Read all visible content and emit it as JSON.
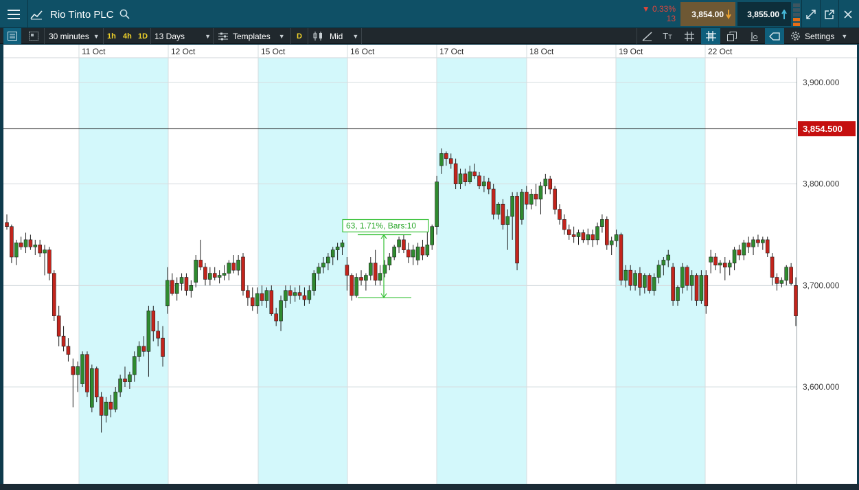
{
  "titlebar": {
    "instrument": "Rio Tinto PLC",
    "change_pct": "▼ 0.33%",
    "change_pts": "13",
    "sell_price": "3,854.00",
    "buy_price": "3,855.00",
    "icons": [
      "menu-icon",
      "chart-icon",
      "search-icon",
      "down-arrow-icon",
      "up-arrow-icon",
      "depth-bars-icon",
      "expand-icon",
      "popout-icon",
      "close-icon"
    ]
  },
  "toolbar": {
    "interval": "30 minutes",
    "btn_1h": "1h",
    "btn_4h": "4h",
    "btn_1d": "1D",
    "period": "13 Days",
    "templates": "Templates",
    "d_btn": "D",
    "price_type": "Mid",
    "settings": "Settings",
    "icons": [
      "list-icon",
      "layout-icon",
      "draw-line-icon",
      "text-icon",
      "grid-icon",
      "crosshair-icon",
      "copy-icon",
      "indicator-icon",
      "tag-icon",
      "gear-icon"
    ]
  },
  "chart_data": {
    "type": "candlestick",
    "x_labels": [
      "11 Oct",
      "12 Oct",
      "15 Oct",
      "16 Oct",
      "17 Oct",
      "18 Oct",
      "19 Oct",
      "22 Oct"
    ],
    "y_ticks": [
      "3,900.000",
      "3,800.000",
      "3,700.000",
      "3,600.000"
    ],
    "y_tick_values": [
      3900,
      3800,
      3700,
      3600
    ],
    "current_price": 3854.5,
    "current_price_label": "3,854.500",
    "measure_label": "63, 1.71%, Bars:10",
    "measure": {
      "from": 3688,
      "to": 3750
    },
    "colors": {
      "up": "#2f8a2f",
      "down": "#c3241c",
      "shade": "#d3f8fb",
      "price_tag": "#c50f0f",
      "measure": "#35c035"
    },
    "candles": [
      [
        3762,
        3770,
        3755,
        3758
      ],
      [
        3758,
        3760,
        3722,
        3728
      ],
      [
        3728,
        3745,
        3720,
        3742
      ],
      [
        3742,
        3748,
        3735,
        3738
      ],
      [
        3738,
        3752,
        3732,
        3745
      ],
      [
        3745,
        3750,
        3735,
        3738
      ],
      [
        3738,
        3745,
        3730,
        3740
      ],
      [
        3740,
        3745,
        3728,
        3732
      ],
      [
        3732,
        3740,
        3710,
        3735
      ],
      [
        3735,
        3738,
        3705,
        3712
      ],
      [
        3712,
        3715,
        3665,
        3670
      ],
      [
        3670,
        3680,
        3640,
        3650
      ],
      [
        3650,
        3660,
        3635,
        3640
      ],
      [
        3640,
        3648,
        3625,
        3632
      ],
      [
        3620,
        3628,
        3580,
        3612
      ],
      [
        3612,
        3625,
        3595,
        3620
      ],
      [
        3603,
        3635,
        3600,
        3632
      ],
      [
        3632,
        3635,
        3590,
        3595
      ],
      [
        3580,
        3622,
        3575,
        3618
      ],
      [
        3618,
        3620,
        3585,
        3590
      ],
      [
        3590,
        3595,
        3555,
        3572
      ],
      [
        3572,
        3590,
        3565,
        3585
      ],
      [
        3585,
        3592,
        3570,
        3578
      ],
      [
        3578,
        3600,
        3575,
        3595
      ],
      [
        3595,
        3612,
        3590,
        3608
      ],
      [
        3608,
        3620,
        3600,
        3605
      ],
      [
        3605,
        3615,
        3598,
        3612
      ],
      [
        3612,
        3635,
        3605,
        3630
      ],
      [
        3630,
        3645,
        3625,
        3640
      ],
      [
        3640,
        3650,
        3630,
        3635
      ],
      [
        3635,
        3680,
        3610,
        3675
      ],
      [
        3675,
        3680,
        3645,
        3655
      ],
      [
        3655,
        3665,
        3640,
        3648
      ],
      [
        3648,
        3660,
        3620,
        3630
      ],
      [
        3680,
        3718,
        3672,
        3705
      ],
      [
        3705,
        3712,
        3690,
        3692
      ],
      [
        3692,
        3708,
        3685,
        3702
      ],
      [
        3702,
        3712,
        3695,
        3708
      ],
      [
        3708,
        3712,
        3690,
        3695
      ],
      [
        3695,
        3705,
        3688,
        3700
      ],
      [
        3703,
        3730,
        3698,
        3725
      ],
      [
        3725,
        3745,
        3715,
        3718
      ],
      [
        3718,
        3722,
        3700,
        3706
      ],
      [
        3706,
        3718,
        3700,
        3712
      ],
      [
        3712,
        3718,
        3705,
        3708
      ],
      [
        3708,
        3715,
        3702,
        3710
      ],
      [
        3710,
        3720,
        3705,
        3712
      ],
      [
        3712,
        3725,
        3705,
        3722
      ],
      [
        3722,
        3730,
        3712,
        3715
      ],
      [
        3715,
        3730,
        3710,
        3725
      ],
      [
        3728,
        3732,
        3690,
        3695
      ],
      [
        3695,
        3700,
        3680,
        3688
      ],
      [
        3688,
        3698,
        3675,
        3680
      ],
      [
        3680,
        3698,
        3672,
        3692
      ],
      [
        3692,
        3700,
        3680,
        3685
      ],
      [
        3685,
        3698,
        3678,
        3695
      ],
      [
        3695,
        3700,
        3670,
        3672
      ],
      [
        3672,
        3678,
        3660,
        3665
      ],
      [
        3665,
        3690,
        3655,
        3685
      ],
      [
        3685,
        3700,
        3678,
        3695
      ],
      [
        3695,
        3700,
        3682,
        3690
      ],
      [
        3690,
        3698,
        3684,
        3693
      ],
      [
        3693,
        3700,
        3686,
        3690
      ],
      [
        3690,
        3698,
        3680,
        3686
      ],
      [
        3686,
        3700,
        3682,
        3695
      ],
      [
        3695,
        3715,
        3690,
        3712
      ],
      [
        3712,
        3722,
        3705,
        3718
      ],
      [
        3718,
        3728,
        3712,
        3722
      ],
      [
        3722,
        3732,
        3715,
        3728
      ],
      [
        3728,
        3738,
        3720,
        3735
      ],
      [
        3735,
        3742,
        3725,
        3738
      ],
      [
        3738,
        3745,
        3730,
        3742
      ],
      [
        3720,
        3728,
        3695,
        3710
      ],
      [
        3710,
        3712,
        3685,
        3690
      ],
      [
        3690,
        3712,
        3688,
        3708
      ],
      [
        3708,
        3715,
        3700,
        3705
      ],
      [
        3705,
        3712,
        3695,
        3710
      ],
      [
        3710,
        3728,
        3705,
        3722
      ],
      [
        3722,
        3735,
        3700,
        3705
      ],
      [
        3705,
        3720,
        3700,
        3712
      ],
      [
        3712,
        3725,
        3708,
        3720
      ],
      [
        3720,
        3732,
        3715,
        3728
      ],
      [
        3728,
        3740,
        3725,
        3738
      ],
      [
        3738,
        3748,
        3732,
        3745
      ],
      [
        3745,
        3750,
        3732,
        3735
      ],
      [
        3735,
        3742,
        3722,
        3728
      ],
      [
        3728,
        3740,
        3720,
        3735
      ],
      [
        3725,
        3742,
        3720,
        3738
      ],
      [
        3738,
        3745,
        3725,
        3730
      ],
      [
        3730,
        3755,
        3728,
        3740
      ],
      [
        3740,
        3760,
        3735,
        3758
      ],
      [
        3758,
        3808,
        3750,
        3802
      ],
      [
        3818,
        3835,
        3810,
        3830
      ],
      [
        3830,
        3832,
        3818,
        3825
      ],
      [
        3825,
        3830,
        3815,
        3820
      ],
      [
        3820,
        3825,
        3795,
        3800
      ],
      [
        3800,
        3815,
        3795,
        3810
      ],
      [
        3810,
        3815,
        3798,
        3802
      ],
      [
        3802,
        3818,
        3800,
        3812
      ],
      [
        3812,
        3820,
        3805,
        3808
      ],
      [
        3808,
        3812,
        3795,
        3798
      ],
      [
        3798,
        3808,
        3792,
        3802
      ],
      [
        3802,
        3806,
        3790,
        3795
      ],
      [
        3795,
        3800,
        3765,
        3770
      ],
      [
        3770,
        3782,
        3765,
        3780
      ],
      [
        3780,
        3785,
        3755,
        3760
      ],
      [
        3760,
        3775,
        3735,
        3768
      ],
      [
        3768,
        3792,
        3745,
        3788
      ],
      [
        3788,
        3792,
        3715,
        3722
      ],
      [
        3765,
        3795,
        3760,
        3792
      ],
      [
        3792,
        3798,
        3775,
        3780
      ],
      [
        3780,
        3795,
        3775,
        3790
      ],
      [
        3790,
        3800,
        3778,
        3785
      ],
      [
        3785,
        3802,
        3770,
        3798
      ],
      [
        3798,
        3810,
        3790,
        3805
      ],
      [
        3805,
        3808,
        3790,
        3795
      ],
      [
        3795,
        3798,
        3770,
        3775
      ],
      [
        3775,
        3780,
        3760,
        3765
      ],
      [
        3765,
        3770,
        3750,
        3755
      ],
      [
        3755,
        3760,
        3745,
        3750
      ],
      [
        3750,
        3758,
        3742,
        3748
      ],
      [
        3748,
        3755,
        3740,
        3752
      ],
      [
        3752,
        3755,
        3742,
        3745
      ],
      [
        3745,
        3756,
        3740,
        3750
      ],
      [
        3750,
        3755,
        3738,
        3745
      ],
      [
        3745,
        3762,
        3740,
        3758
      ],
      [
        3758,
        3770,
        3752,
        3765
      ],
      [
        3765,
        3768,
        3735,
        3740
      ],
      [
        3740,
        3748,
        3730,
        3744
      ],
      [
        3744,
        3755,
        3738,
        3750
      ],
      [
        3750,
        3752,
        3700,
        3705
      ],
      [
        3705,
        3720,
        3698,
        3715
      ],
      [
        3715,
        3720,
        3695,
        3700
      ],
      [
        3700,
        3715,
        3695,
        3712
      ],
      [
        3712,
        3718,
        3690,
        3698
      ],
      [
        3698,
        3712,
        3692,
        3710
      ],
      [
        3710,
        3712,
        3692,
        3695
      ],
      [
        3695,
        3712,
        3690,
        3708
      ],
      [
        3708,
        3725,
        3702,
        3720
      ],
      [
        3720,
        3728,
        3710,
        3725
      ],
      [
        3725,
        3735,
        3718,
        3730
      ],
      [
        3718,
        3722,
        3680,
        3685
      ],
      [
        3685,
        3700,
        3680,
        3698
      ],
      [
        3698,
        3722,
        3692,
        3718
      ],
      [
        3718,
        3720,
        3695,
        3700
      ],
      [
        3700,
        3715,
        3685,
        3710
      ],
      [
        3710,
        3712,
        3680,
        3685
      ],
      [
        3685,
        3715,
        3682,
        3710
      ],
      [
        3710,
        3715,
        3672,
        3680
      ],
      [
        3723,
        3735,
        3712,
        3728
      ],
      [
        3728,
        3732,
        3715,
        3720
      ],
      [
        3720,
        3725,
        3712,
        3722
      ],
      [
        3722,
        3728,
        3705,
        3718
      ],
      [
        3718,
        3725,
        3710,
        3722
      ],
      [
        3722,
        3738,
        3715,
        3735
      ],
      [
        3735,
        3740,
        3725,
        3730
      ],
      [
        3730,
        3745,
        3725,
        3742
      ],
      [
        3742,
        3748,
        3732,
        3738
      ],
      [
        3738,
        3748,
        3730,
        3745
      ],
      [
        3745,
        3750,
        3738,
        3742
      ],
      [
        3742,
        3748,
        3735,
        3745
      ],
      [
        3745,
        3748,
        3728,
        3732
      ],
      [
        3728,
        3732,
        3700,
        3708
      ],
      [
        3708,
        3712,
        3695,
        3702
      ],
      [
        3702,
        3708,
        3698,
        3705
      ],
      [
        3705,
        3720,
        3700,
        3718
      ],
      [
        3718,
        3722,
        3700,
        3702
      ],
      [
        3700,
        3708,
        3660,
        3670
      ]
    ]
  }
}
